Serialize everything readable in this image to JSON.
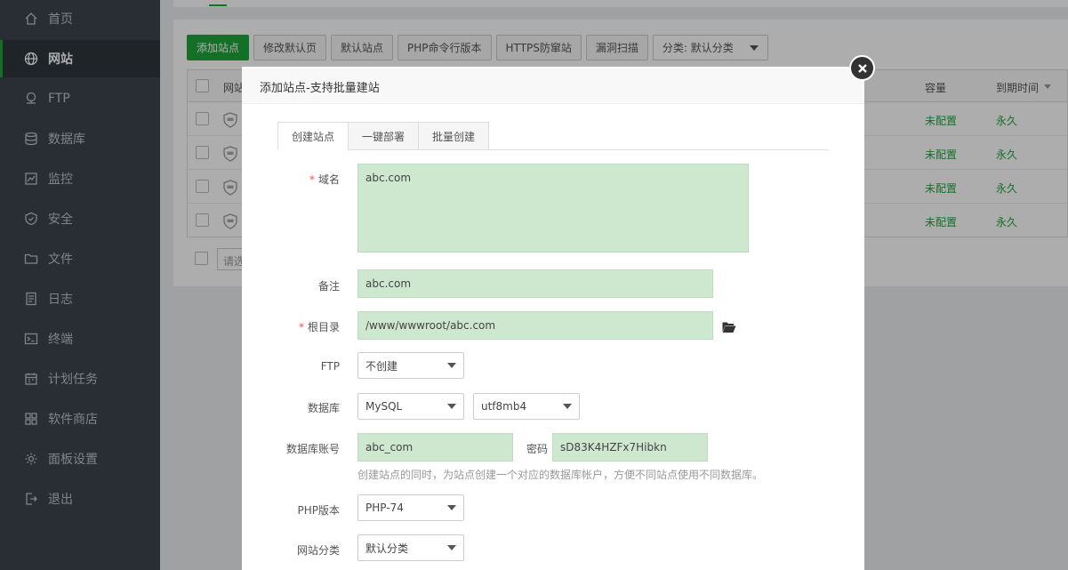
{
  "sidebar": {
    "items": [
      {
        "label": "首页",
        "icon": "home-icon"
      },
      {
        "label": "网站",
        "icon": "globe-icon",
        "active": true
      },
      {
        "label": "FTP",
        "icon": "ftp-icon"
      },
      {
        "label": "数据库",
        "icon": "database-icon"
      },
      {
        "label": "监控",
        "icon": "monitor-icon"
      },
      {
        "label": "安全",
        "icon": "shield-icon"
      },
      {
        "label": "文件",
        "icon": "folder-icon"
      },
      {
        "label": "日志",
        "icon": "log-icon"
      },
      {
        "label": "终端",
        "icon": "terminal-icon"
      },
      {
        "label": "计划任务",
        "icon": "calendar-icon"
      },
      {
        "label": "软件商店",
        "icon": "apps-icon"
      },
      {
        "label": "面板设置",
        "icon": "gear-icon"
      },
      {
        "label": "退出",
        "icon": "logout-icon"
      }
    ]
  },
  "toolbar": {
    "add_site": "添加站点",
    "edit_default_page": "修改默认页",
    "default_site": "默认站点",
    "php_cli_version": "PHP命令行版本",
    "https_protection": "HTTPS防窜站",
    "vuln_scan": "漏洞扫描",
    "category_select": "分类: 默认分类"
  },
  "table": {
    "headers": {
      "site": "网站",
      "capacity": "容量",
      "expire": "到期时间"
    },
    "rows": [
      {
        "capacity": "未配置",
        "expire": "永久"
      },
      {
        "capacity": "未配置",
        "expire": "永久"
      },
      {
        "capacity": "未配置",
        "expire": "永久"
      },
      {
        "capacity": "未配置",
        "expire": "永久"
      }
    ],
    "batch_placeholder": "请选"
  },
  "modal": {
    "title": "添加站点-支持批量建站",
    "tabs": [
      "创建站点",
      "一键部署",
      "批量创建"
    ],
    "labels": {
      "domain": "域名",
      "remark": "备注",
      "root": "根目录",
      "ftp": "FTP",
      "database": "数据库",
      "db_user": "数据库账号",
      "password": "密码",
      "php": "PHP版本",
      "category": "网站分类"
    },
    "required_mark": "*",
    "values": {
      "domain": "abc.com",
      "remark": "abc.com",
      "root": "/www/wwwroot/abc.com",
      "ftp": "不创建",
      "db_type": "MySQL",
      "db_charset": "utf8mb4",
      "db_user": "abc_com",
      "db_password": "sD83K4HZFx7Hibkn",
      "php": "PHP-74",
      "category": "默认分类"
    },
    "db_hint": "创建站点的同时，为站点创建一个对应的数据库帐户，方便不同站点使用不同数据库。"
  },
  "colors": {
    "accent": "#20a53a",
    "sidebar_bg": "#3c444d",
    "field_bg": "#cde8cf"
  }
}
